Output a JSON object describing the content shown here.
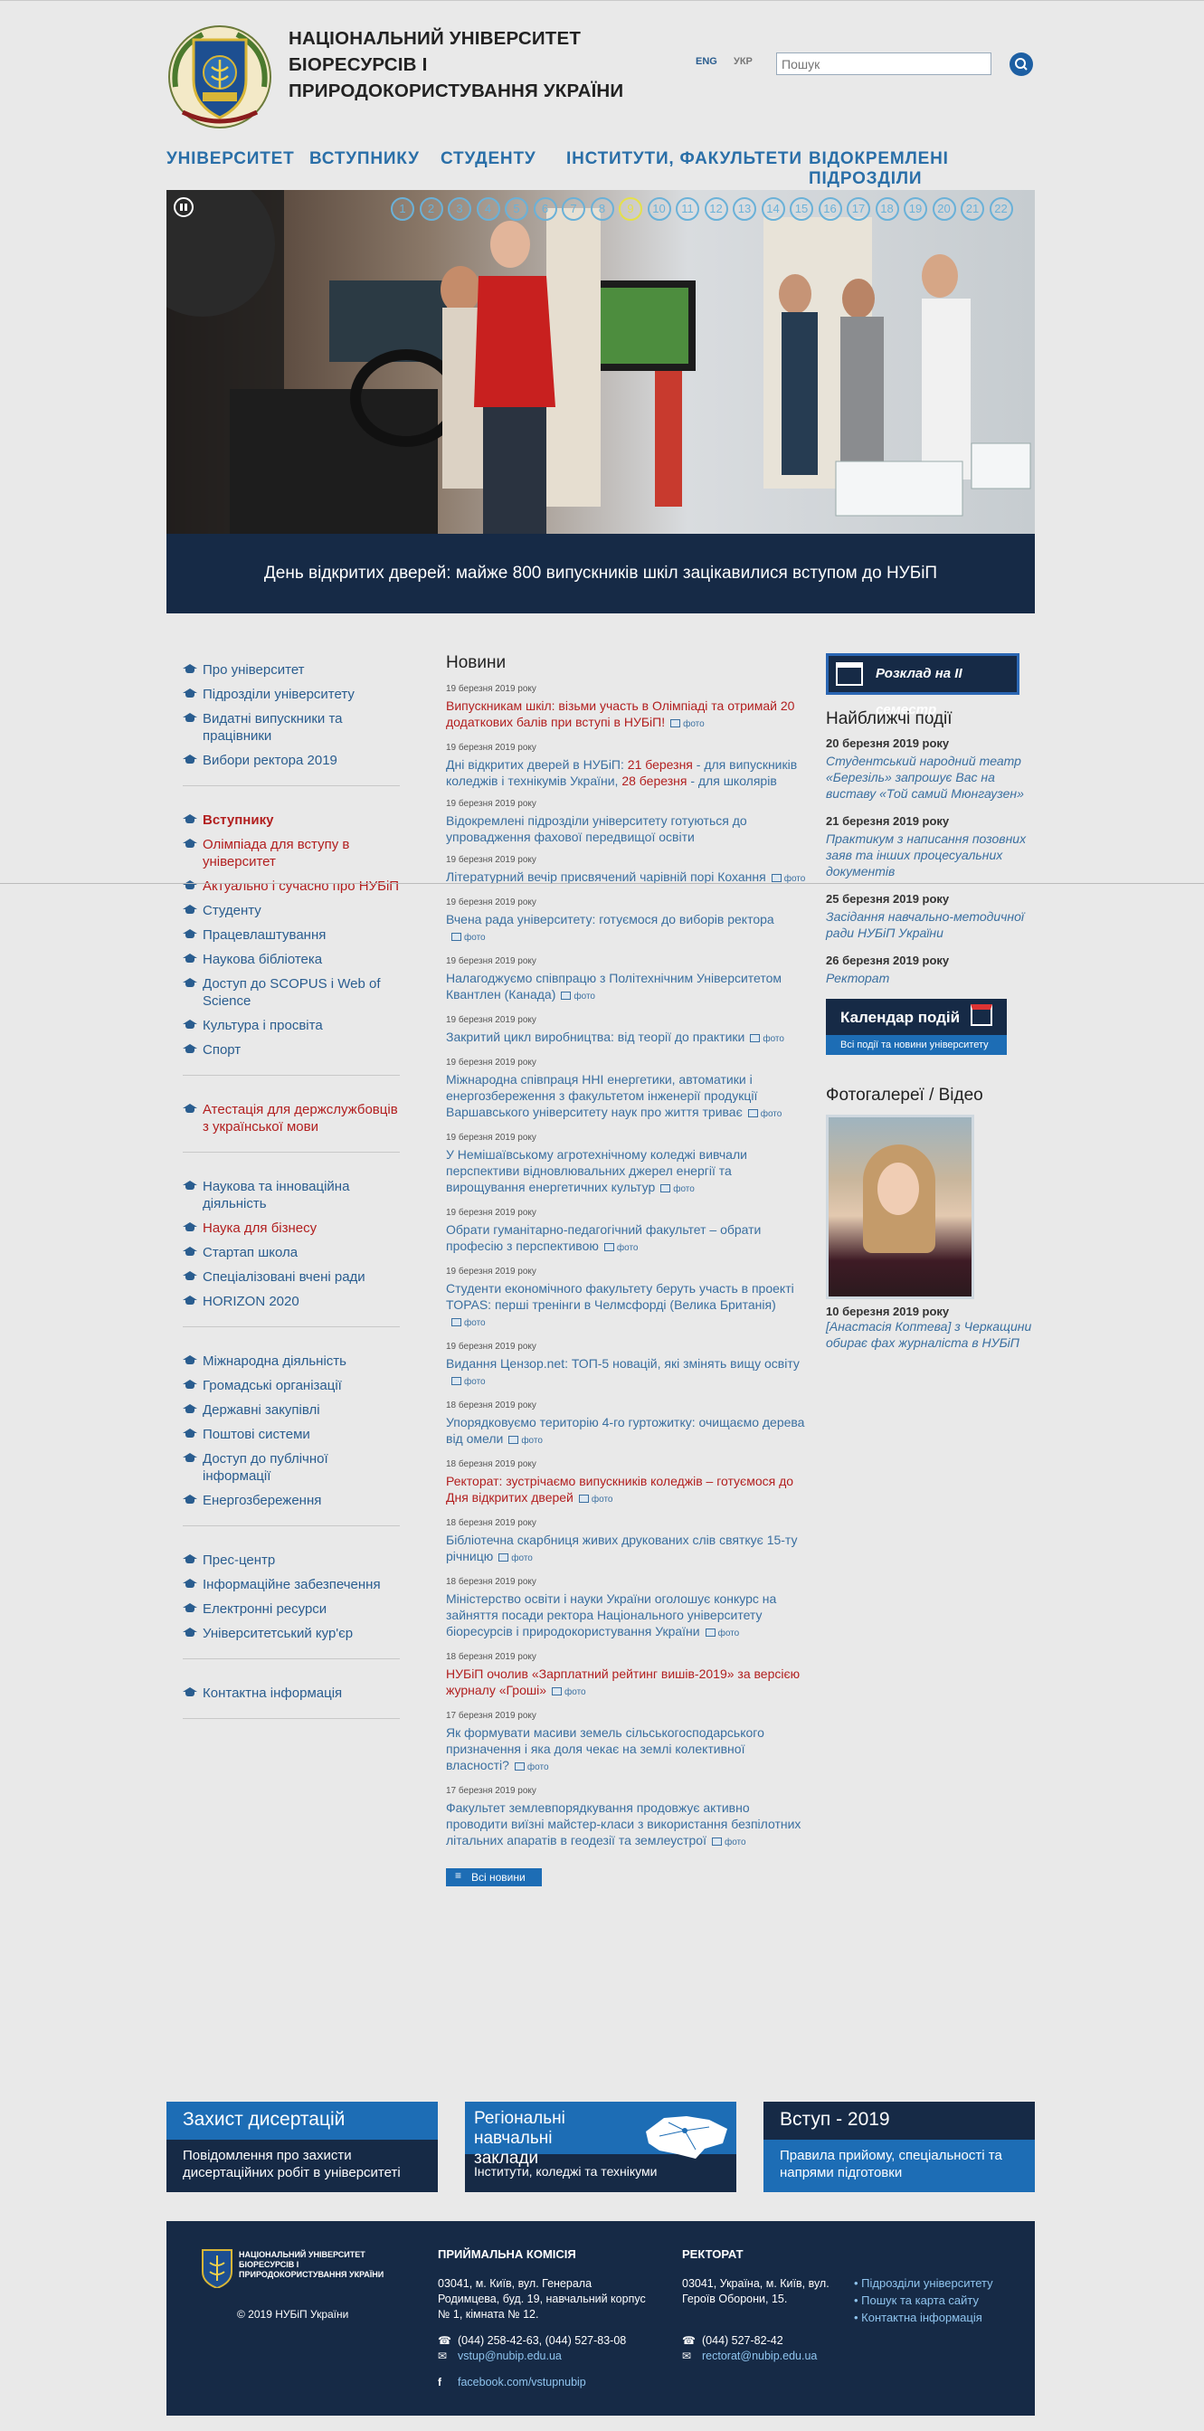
{
  "header": {
    "title": "НАЦІОНАЛЬНИЙ УНІВЕРСИТЕТ БІОРЕСУРСІВ І ПРИРОДОКОРИСТУВАННЯ УКРАЇНИ",
    "lang_en": "ENG",
    "lang_uk": "УКР",
    "search_placeholder": "Пошук"
  },
  "nav": {
    "university": "УНІВЕРСИТЕТ",
    "applicant": "ВСТУПНИКУ",
    "student": "СТУДЕНТУ",
    "institutes": "ІНСТИТУТИ, ФАКУЛЬТЕТИ",
    "branches": "ВІДОКРЕМЛЕНІ ПІДРОЗДІЛИ"
  },
  "slider": {
    "caption": "День відкритих дверей: майже 800 випускників шкіл зацікавилися вступом до НУБіП",
    "dots": [
      "1",
      "2",
      "3",
      "4",
      "5",
      "6",
      "7",
      "8",
      "9",
      "10",
      "11",
      "12",
      "13",
      "14",
      "15",
      "16",
      "17",
      "18",
      "19",
      "20",
      "21",
      "22"
    ],
    "active_dot": "9"
  },
  "left_menu": {
    "g1": [
      "Про університет",
      "Підрозділи університету",
      "Видатні випускники та працівники",
      "Вибори ректора 2019"
    ],
    "g2_head": "Вступнику",
    "g2_red": [
      "Олімпіада для вступу в університет",
      "Актуально і сучасно про НУБіП"
    ],
    "g2": [
      "Студенту",
      "Працевлаштування",
      "Наукова бібліотека",
      "Доступ до SCOPUS і Web of Science",
      "Культура і просвіта",
      "Спорт"
    ],
    "g3": [
      "Атестація для держслужбовців з української мови"
    ],
    "g4a": "Наукова та інноваційна діяльність",
    "g4b": "Наука для бізнесу",
    "g4": [
      "Стартап школа",
      "Спеціалізовані вчені ради",
      "HORIZON 2020"
    ],
    "g5": [
      "Міжнародна діяльність",
      "Громадські організації",
      "Державні закупівлі",
      "Поштові системи",
      "Доступ до публічної інформації",
      "Енергозбереження"
    ],
    "g6": [
      "Прес-центр",
      "Інформаційне забезпечення",
      "Електронні ресурси",
      "Університетський кур'єр"
    ],
    "g7": [
      "Контактна інформація"
    ]
  },
  "news": {
    "heading": "Новини",
    "foto_label": "фото",
    "all_label": "Всі новини",
    "items": [
      {
        "date": "19 березня 2019 року",
        "title": "Випускникам шкіл: візьми участь в Олімпіаді та отримай 20 додаткових балів при вступі в НУБіП!"
      },
      {
        "date": "19 березня 2019 року",
        "title_a": "Дні відкритих дверей в НУБіП: ",
        "title_b": "21 березня",
        "title_c": " - для випускників коледжів і технікумів України, ",
        "title_d": "28 березня",
        "title_e": " - для школярів"
      },
      {
        "date": "19 березня 2019 року",
        "title": "Відокремлені підрозділи університету готуються до упровадження фахової передвищої освіти"
      },
      {
        "date": "19 березня 2019 року",
        "title": "Літературний вечір присвячений чарівній порі Кохання"
      },
      {
        "date": "19 березня 2019 року",
        "title": "Вчена рада університету: готуємося до виборів ректора"
      },
      {
        "date": "19 березня 2019 року",
        "title": "Налагоджуємо співпрацю з Політехнічним Університетом Квантлен (Канада)"
      },
      {
        "date": "19 березня 2019 року",
        "title": "Закритий цикл виробництва: від теорії до практики"
      },
      {
        "date": "19 березня 2019 року",
        "title": "Міжнародна співпраця ННІ енергетики, автоматики і енергозбереження з факультетом інженерії продукції Варшавського університету наук про життя триває"
      },
      {
        "date": "19 березня 2019 року",
        "title": "У Немішаївському агротехнічному коледжі вивчали перспективи відновлювальних джерел енергії та вирощування енергетичних культур"
      },
      {
        "date": "19 березня 2019 року",
        "title": "Обрати гуманітарно-педагогічний факультет – обрати професію з перспективою"
      },
      {
        "date": "19 березня 2019 року",
        "title": "Студенти економічного факультету беруть участь в проекті TOPAS: перші тренінги в Челмсфорді (Велика Британія)"
      },
      {
        "date": "19 березня 2019 року",
        "title": "Видання Цензор.net: ТОП-5 новацій, які змінять вищу освіту"
      },
      {
        "date": "18 березня 2019 року",
        "title": "Упорядковуємо територію 4-го гуртожитку: очищаємо дерева від омели"
      },
      {
        "date": "18 березня 2019 року",
        "title": "Ректорат: зустрічаємо випускників коледжів – готуємося до Дня відкритих дверей"
      },
      {
        "date": "18 березня 2019 року",
        "title": "Бібліотечна скарбниця живих друкованих слів святкує 15-ту річницю"
      },
      {
        "date": "18 березня 2019 року",
        "title": "Міністерство освіти і науки України оголошує конкурс на зайняття посади ректора Національного університету біоресурсів і природокористування України"
      },
      {
        "date": "18 березня 2019 року",
        "title": "НУБіП очолив «Зарплатний рейтинг вишів-2019» за версією журналу «Гроші»"
      },
      {
        "date": "17 березня 2019 року",
        "title": "Як формувати масиви земель сільськогосподарського призначення і яка доля чекає на землі колективної власності?"
      },
      {
        "date": "17 березня 2019 року",
        "title": "Факультет землевпорядкування продовжує активно проводити виїзні майстер-класи з використання безпілотних літальних апаратів в геодезії та землеустрої"
      }
    ]
  },
  "right": {
    "schedule": "Розклад на II семестр",
    "events_heading": "Найближчі події",
    "events": [
      {
        "date": "20 березня 2019 року",
        "title": "Студентський народний театр «Березіль» запрошує Вас на виставу «Той самий Мюнгаузен»"
      },
      {
        "date": "21 березня 2019 року",
        "title": "Практикум з написання позовних заяв та інших процесуальних документів"
      },
      {
        "date": "25 березня 2019 року",
        "title": "Засідання навчально-методичної ради НУБіП України"
      },
      {
        "date": "26 березня 2019 року",
        "title": "Ректорат"
      }
    ],
    "calendar_title": "Календар подій",
    "calendar_sub": "Всі події та новини університету",
    "gallery_heading": "Фотогалереї / Відео",
    "gallery_date": "10 березня 2019 року",
    "gallery_title": "[Анастасія Коптева] з Черкащини обирає фах журналіста в НУБіП"
  },
  "promo": {
    "p1_title": "Захист дисертацій",
    "p1_text": "Повідомлення про захисти дисертаційних робіт в університеті",
    "p2_title": "Регіональні навчальні заклади",
    "p2_text": "Інститути, коледжі та технікуми",
    "p3_title": "Вступ - 2019",
    "p3_text": "Правила прийому, спеціальності та напрями підготовки"
  },
  "footer": {
    "logo_text": "НАЦІОНАЛЬНИЙ УНІВЕРСИТЕТ БІОРЕСУРСІВ І ПРИРОДОКОРИСТУВАННЯ УКРАЇНИ",
    "copyright": "© 2019 НУБіП України",
    "admission_head": "ПРИЙМАЛЬНА КОМІСІЯ",
    "admission_addr": "03041, м. Київ, вул. Генерала Родимцева, буд. 19, навчальний корпус № 1, кімната № 12.",
    "admission_phone": "(044) 258-42-63, (044) 527-83-08",
    "admission_mail": "vstup@nubip.edu.ua",
    "admission_fb": "facebook.com/vstupnubip",
    "rector_head": "РЕКТОРАТ",
    "rector_addr": "03041, Україна, м. Київ, вул. Героїв Оборони, 15.",
    "rector_phone": "(044) 527-82-42",
    "rector_mail": "rectorat@nubip.edu.ua",
    "links": [
      "Підрозділи університету",
      "Пошук та карта сайту",
      "Контактна інформація"
    ]
  },
  "colors": {
    "navy": "#162a46",
    "blue": "#1d6db5",
    "link": "#2a5d8f",
    "red": "#b21f1f"
  }
}
